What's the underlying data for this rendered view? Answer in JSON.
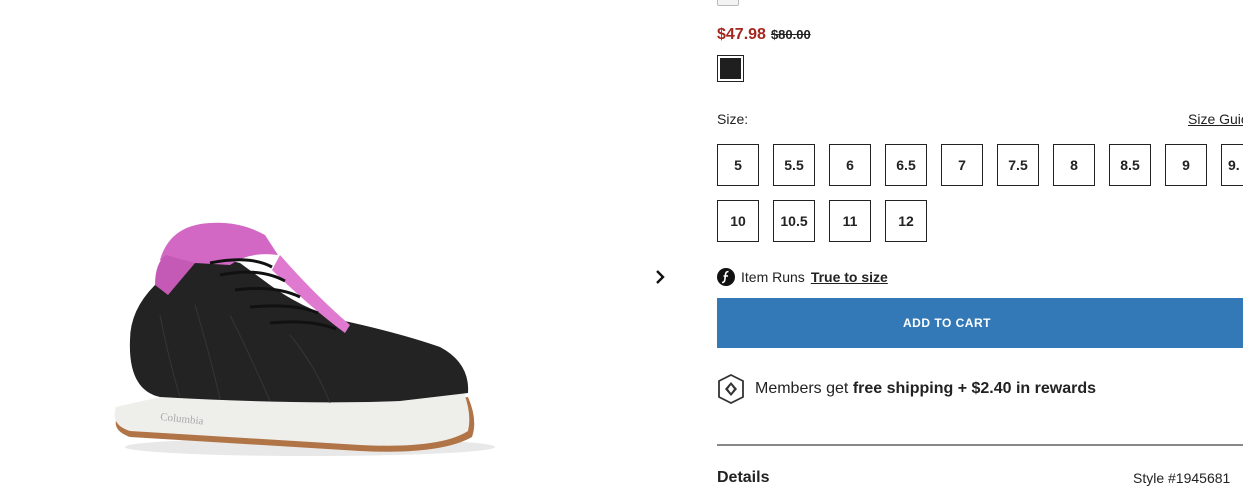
{
  "product": {
    "sale_price": "$47.98",
    "original_price": "$80.00",
    "selected_color": "#1f1f1f",
    "sale_color": "#a3271f"
  },
  "size_section": {
    "label": "Size:",
    "guide_link": "Size Guic",
    "sizes": [
      "5",
      "5.5",
      "6",
      "6.5",
      "7",
      "7.5",
      "8",
      "8.5",
      "9",
      "9.",
      "10",
      "10.5",
      "11",
      "12"
    ]
  },
  "fit": {
    "prefix": "Item Runs",
    "value": "True to size"
  },
  "cart": {
    "button_label": "ADD TO CART",
    "button_color": "#3479b7"
  },
  "members": {
    "text_prefix": "Members get ",
    "text_bold": "free shipping + $2.40 in rewards"
  },
  "details": {
    "heading": "Details",
    "style": "Style #1945681"
  },
  "gallery": {
    "next_icon": "chevron-right-icon",
    "shoe_brand": "Columbia"
  }
}
